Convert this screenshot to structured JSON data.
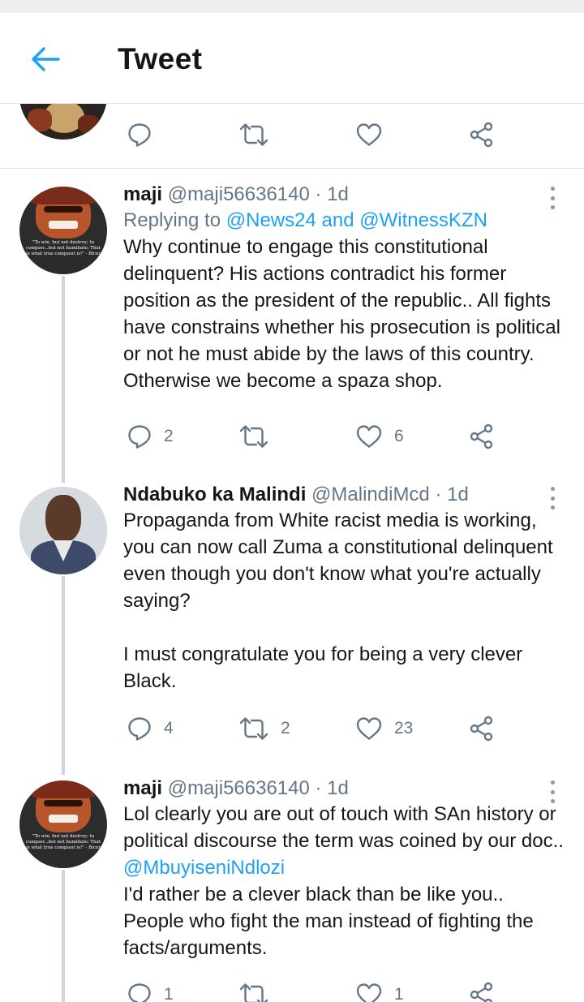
{
  "header": {
    "title": "Tweet",
    "back_icon": "arrow-left-icon",
    "accent": "#1da1f2"
  },
  "tweets": [
    {
      "name": "maji",
      "handle": "@maji56636140",
      "dot": "·",
      "time": "1d",
      "reply_prefix": "Replying to ",
      "reply_a": "@News24",
      "reply_and": " and ",
      "reply_b": "@WitnessKZN",
      "text": "Why continue to engage this constitutional delinquent? His actions contradict his former position as the president of the republic.. All fights have constrains whether his prosecution is political or not he must abide by the laws of this country. Otherwise we become a spaza shop.",
      "replies": "2",
      "retweets": "",
      "likes": "6",
      "avatar_quote": "\"To win, but not destroy; to conquer...but not humiliate; That is what true conquest is!\" - Bicer"
    },
    {
      "name": "Ndabuko ka Malindi",
      "handle": "@MalindiMcd",
      "dot": "·",
      "time": "1d",
      "text": "Propaganda from White racist media is working, you can now call Zuma a constitutional delinquent even though you don't know what you're actually saying?\n\nI must congratulate you for being a very clever Black.",
      "replies": "4",
      "retweets": "2",
      "likes": "23"
    },
    {
      "name": "maji",
      "handle": "@maji56636140",
      "dot": "·",
      "time": "1d",
      "text_a": "Lol clearly you are out of touch with SAn history or political discourse the term was coined by our doc.. ",
      "mention": "@MbuyiseniNdlozi",
      "text_b": "\nI'd rather be a clever black than be like you.. People who fight the man instead of fighting the facts/arguments.",
      "replies": "1",
      "retweets": "",
      "likes": "1",
      "avatar_quote": "\"To win, but not destroy; to conquer...but not humiliate; That is what true conquest is!\" - Bicer"
    }
  ],
  "icons": {
    "reply": "reply-icon",
    "retweet": "retweet-icon",
    "like": "heart-icon",
    "share": "share-icon",
    "more": "more-vertical-icon"
  }
}
